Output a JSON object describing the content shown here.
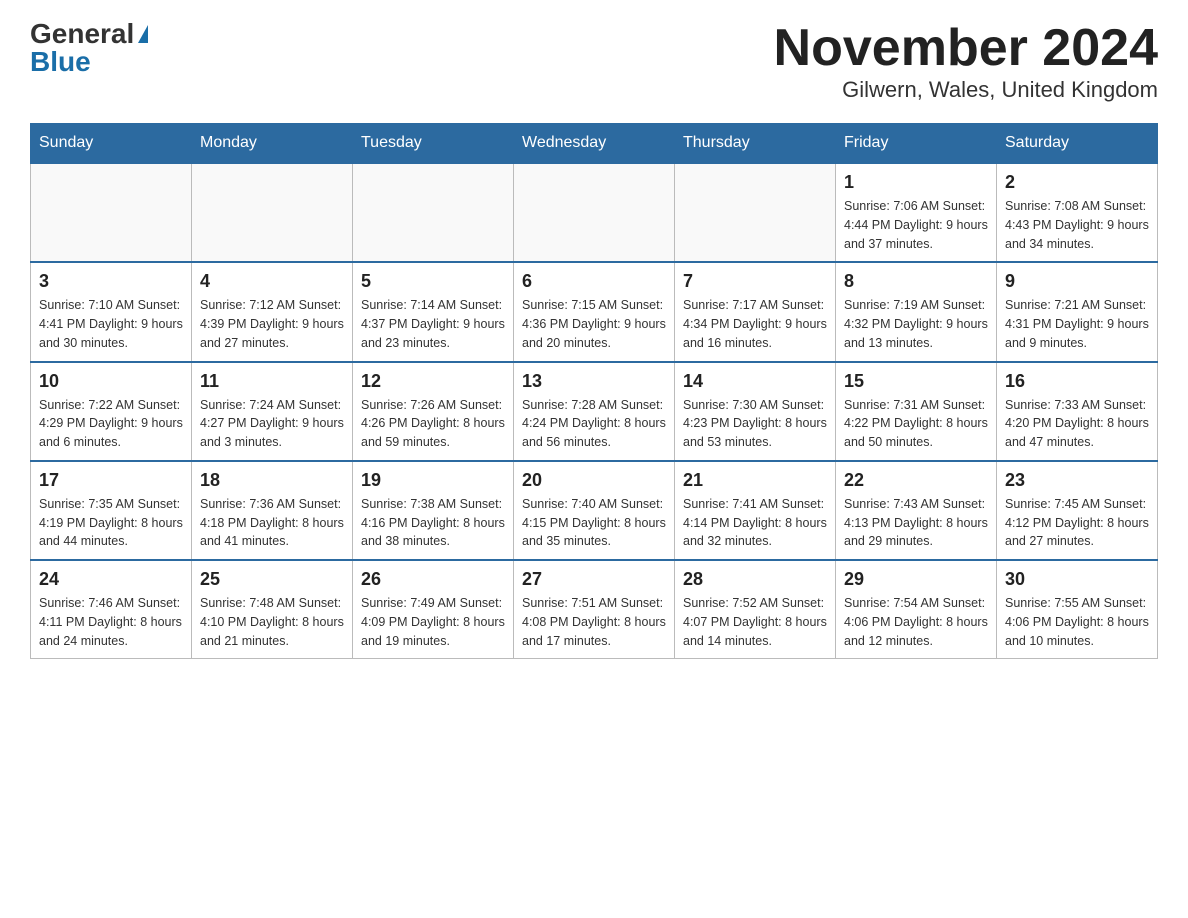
{
  "header": {
    "logo_general": "General",
    "logo_blue": "Blue",
    "title": "November 2024",
    "subtitle": "Gilwern, Wales, United Kingdom"
  },
  "days_of_week": [
    "Sunday",
    "Monday",
    "Tuesday",
    "Wednesday",
    "Thursday",
    "Friday",
    "Saturday"
  ],
  "weeks": [
    [
      {
        "day": "",
        "info": ""
      },
      {
        "day": "",
        "info": ""
      },
      {
        "day": "",
        "info": ""
      },
      {
        "day": "",
        "info": ""
      },
      {
        "day": "",
        "info": ""
      },
      {
        "day": "1",
        "info": "Sunrise: 7:06 AM\nSunset: 4:44 PM\nDaylight: 9 hours and 37 minutes."
      },
      {
        "day": "2",
        "info": "Sunrise: 7:08 AM\nSunset: 4:43 PM\nDaylight: 9 hours and 34 minutes."
      }
    ],
    [
      {
        "day": "3",
        "info": "Sunrise: 7:10 AM\nSunset: 4:41 PM\nDaylight: 9 hours and 30 minutes."
      },
      {
        "day": "4",
        "info": "Sunrise: 7:12 AM\nSunset: 4:39 PM\nDaylight: 9 hours and 27 minutes."
      },
      {
        "day": "5",
        "info": "Sunrise: 7:14 AM\nSunset: 4:37 PM\nDaylight: 9 hours and 23 minutes."
      },
      {
        "day": "6",
        "info": "Sunrise: 7:15 AM\nSunset: 4:36 PM\nDaylight: 9 hours and 20 minutes."
      },
      {
        "day": "7",
        "info": "Sunrise: 7:17 AM\nSunset: 4:34 PM\nDaylight: 9 hours and 16 minutes."
      },
      {
        "day": "8",
        "info": "Sunrise: 7:19 AM\nSunset: 4:32 PM\nDaylight: 9 hours and 13 minutes."
      },
      {
        "day": "9",
        "info": "Sunrise: 7:21 AM\nSunset: 4:31 PM\nDaylight: 9 hours and 9 minutes."
      }
    ],
    [
      {
        "day": "10",
        "info": "Sunrise: 7:22 AM\nSunset: 4:29 PM\nDaylight: 9 hours and 6 minutes."
      },
      {
        "day": "11",
        "info": "Sunrise: 7:24 AM\nSunset: 4:27 PM\nDaylight: 9 hours and 3 minutes."
      },
      {
        "day": "12",
        "info": "Sunrise: 7:26 AM\nSunset: 4:26 PM\nDaylight: 8 hours and 59 minutes."
      },
      {
        "day": "13",
        "info": "Sunrise: 7:28 AM\nSunset: 4:24 PM\nDaylight: 8 hours and 56 minutes."
      },
      {
        "day": "14",
        "info": "Sunrise: 7:30 AM\nSunset: 4:23 PM\nDaylight: 8 hours and 53 minutes."
      },
      {
        "day": "15",
        "info": "Sunrise: 7:31 AM\nSunset: 4:22 PM\nDaylight: 8 hours and 50 minutes."
      },
      {
        "day": "16",
        "info": "Sunrise: 7:33 AM\nSunset: 4:20 PM\nDaylight: 8 hours and 47 minutes."
      }
    ],
    [
      {
        "day": "17",
        "info": "Sunrise: 7:35 AM\nSunset: 4:19 PM\nDaylight: 8 hours and 44 minutes."
      },
      {
        "day": "18",
        "info": "Sunrise: 7:36 AM\nSunset: 4:18 PM\nDaylight: 8 hours and 41 minutes."
      },
      {
        "day": "19",
        "info": "Sunrise: 7:38 AM\nSunset: 4:16 PM\nDaylight: 8 hours and 38 minutes."
      },
      {
        "day": "20",
        "info": "Sunrise: 7:40 AM\nSunset: 4:15 PM\nDaylight: 8 hours and 35 minutes."
      },
      {
        "day": "21",
        "info": "Sunrise: 7:41 AM\nSunset: 4:14 PM\nDaylight: 8 hours and 32 minutes."
      },
      {
        "day": "22",
        "info": "Sunrise: 7:43 AM\nSunset: 4:13 PM\nDaylight: 8 hours and 29 minutes."
      },
      {
        "day": "23",
        "info": "Sunrise: 7:45 AM\nSunset: 4:12 PM\nDaylight: 8 hours and 27 minutes."
      }
    ],
    [
      {
        "day": "24",
        "info": "Sunrise: 7:46 AM\nSunset: 4:11 PM\nDaylight: 8 hours and 24 minutes."
      },
      {
        "day": "25",
        "info": "Sunrise: 7:48 AM\nSunset: 4:10 PM\nDaylight: 8 hours and 21 minutes."
      },
      {
        "day": "26",
        "info": "Sunrise: 7:49 AM\nSunset: 4:09 PM\nDaylight: 8 hours and 19 minutes."
      },
      {
        "day": "27",
        "info": "Sunrise: 7:51 AM\nSunset: 4:08 PM\nDaylight: 8 hours and 17 minutes."
      },
      {
        "day": "28",
        "info": "Sunrise: 7:52 AM\nSunset: 4:07 PM\nDaylight: 8 hours and 14 minutes."
      },
      {
        "day": "29",
        "info": "Sunrise: 7:54 AM\nSunset: 4:06 PM\nDaylight: 8 hours and 12 minutes."
      },
      {
        "day": "30",
        "info": "Sunrise: 7:55 AM\nSunset: 4:06 PM\nDaylight: 8 hours and 10 minutes."
      }
    ]
  ]
}
